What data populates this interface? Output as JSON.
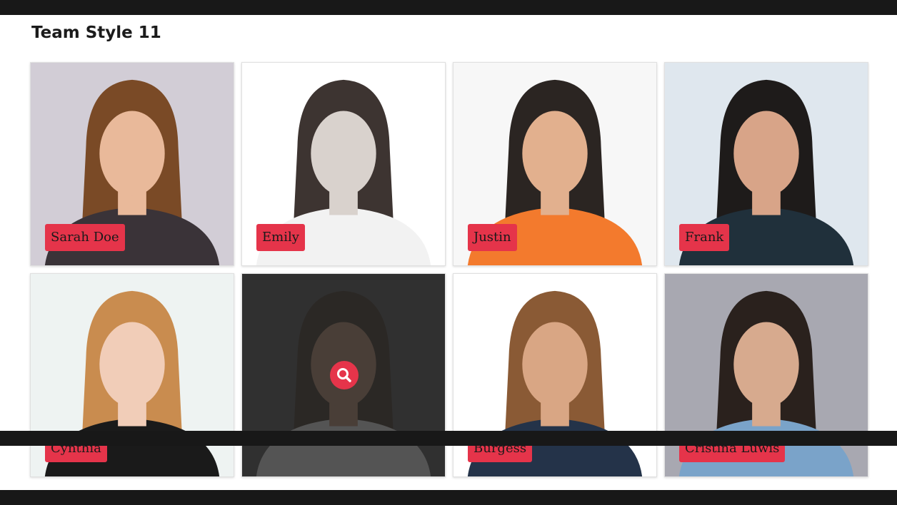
{
  "page": {
    "title": "Team Style 11"
  },
  "accent_color": "#e5344a",
  "members": [
    {
      "name": "Sarah Doe",
      "bg": "#d2cdd6",
      "hair": "#7a4a26",
      "skin": "#e9b99a",
      "shirt": "#3a3338"
    },
    {
      "name": "Emily",
      "bg": "#ffffff",
      "hair": "#3d3431",
      "skin": "#d9d2cd",
      "shirt": "#f2f2f2"
    },
    {
      "name": "Justin",
      "bg": "#f7f7f7",
      "hair": "#2b2522",
      "skin": "#e2b08e",
      "shirt": "#f37a2d"
    },
    {
      "name": "Frank",
      "bg": "#dfe7ee",
      "hair": "#1e1b1a",
      "skin": "#d8a488",
      "shirt": "#20303b"
    },
    {
      "name": "Cynthia",
      "bg": "#eef3f2",
      "hair": "#c98c4f",
      "skin": "#f1cdb8",
      "shirt": "#1a1a1a"
    },
    {
      "name": "",
      "bg": "#4d4d4d",
      "hair": "#3a2a1e",
      "skin": "#bd8c6e",
      "shirt": "#f2f2f2",
      "hovered": true,
      "hover_icon": "search-icon"
    },
    {
      "name": "Burgess",
      "bg": "#ffffff",
      "hair": "#8a5a35",
      "skin": "#d9a684",
      "shirt": "#243349"
    },
    {
      "name": "Cristina Luwis",
      "bg": "#a8a8b1",
      "hair": "#2a211d",
      "skin": "#d7aa8e",
      "shirt": "#7aa3c9"
    }
  ]
}
